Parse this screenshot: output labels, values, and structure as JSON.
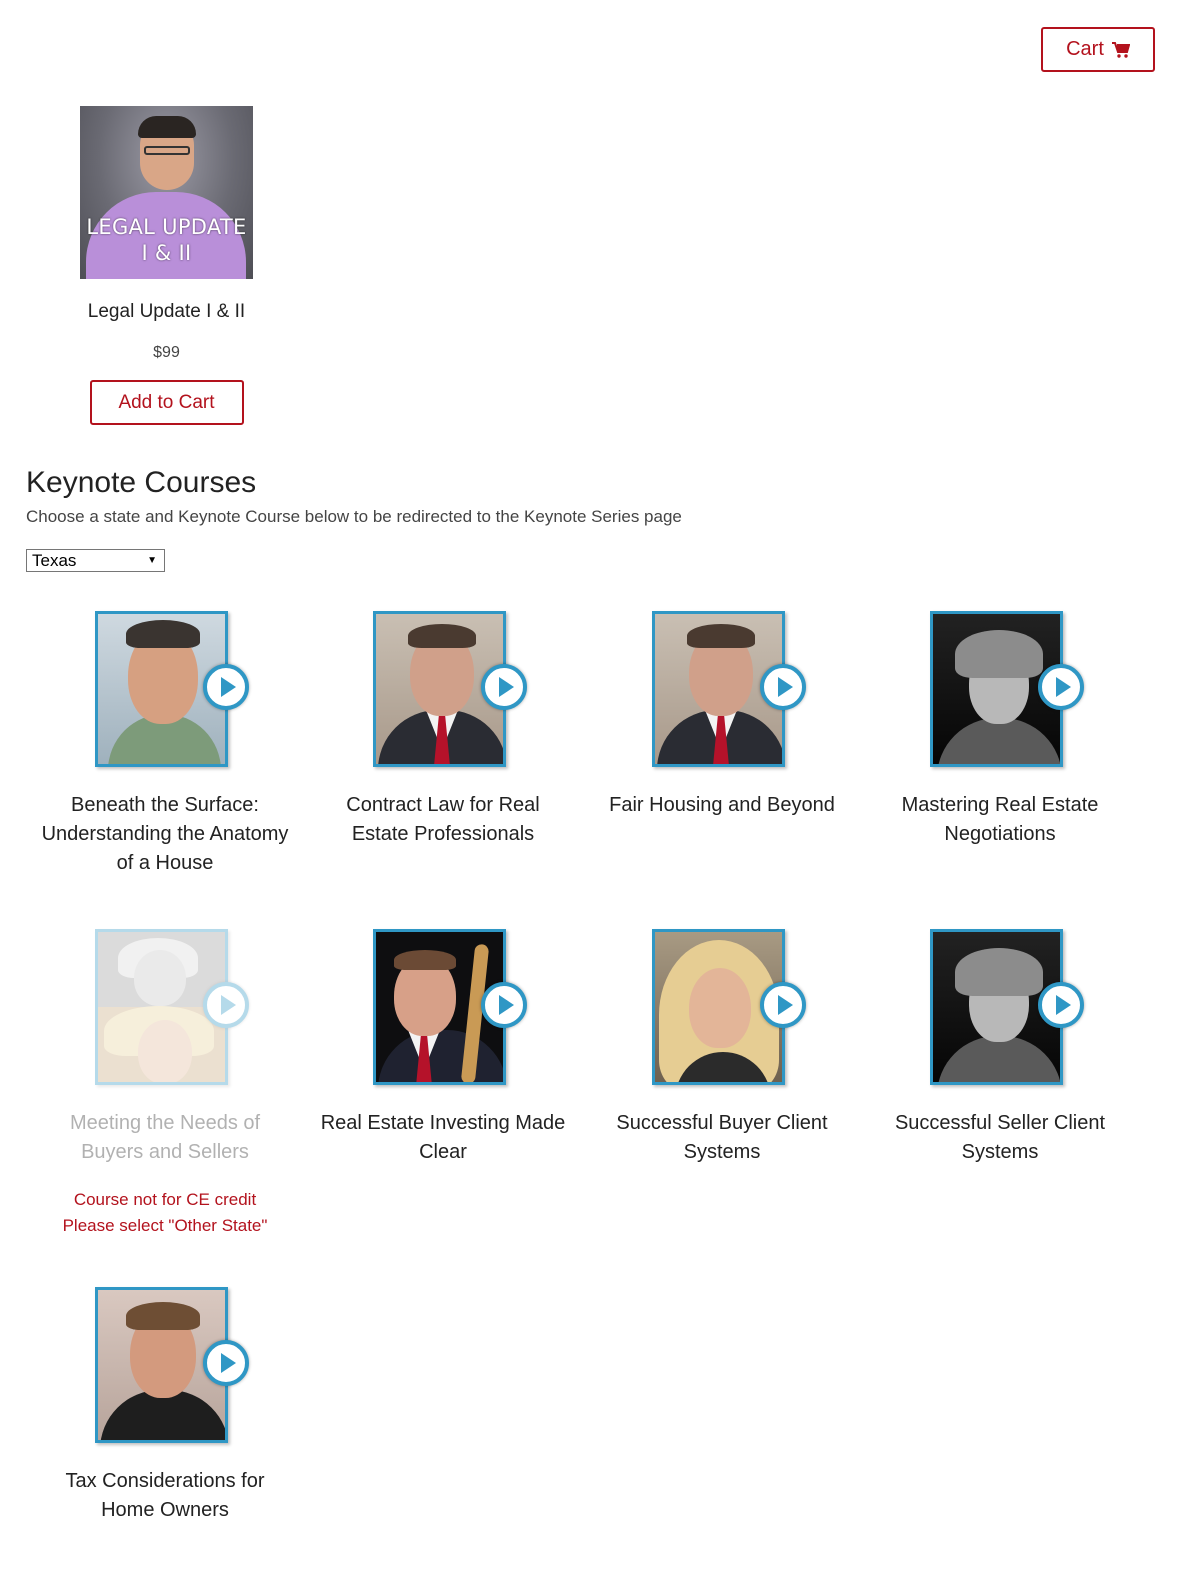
{
  "header": {
    "cart_label": "Cart",
    "cart_icon": "shopping-cart-icon"
  },
  "product": {
    "image_overlay_line1": "LEGAL UPDATE",
    "image_overlay_line2": "I & II",
    "title": "Legal Update I & II",
    "price": "$99",
    "add_to_cart_label": "Add to Cart"
  },
  "keynote": {
    "heading": "Keynote Courses",
    "description": "Choose a state and Keynote Course below to be redirected to the Keynote Series page",
    "state_select_value": "Texas"
  },
  "courses": [
    {
      "title": "Beneath the Surface: Understanding the Anatomy of a House"
    },
    {
      "title": "Contract Law for Real Estate Professionals"
    },
    {
      "title": "Fair Housing and Beyond"
    },
    {
      "title": "Mastering Real Estate Negotiations"
    },
    {
      "title": "Meeting the Needs of Buyers and Sellers",
      "note_line1": "Course not for CE credit",
      "note_line2": "Please select \"Other State\""
    },
    {
      "title": "Real Estate Investing Made Clear"
    },
    {
      "title": "Successful Buyer Client Systems"
    },
    {
      "title": "Successful Seller Client Systems"
    },
    {
      "title": "Tax Considerations for Home Owners"
    }
  ],
  "colors": {
    "accent_red": "#b3121d",
    "frame_blue": "#2f97c5"
  }
}
